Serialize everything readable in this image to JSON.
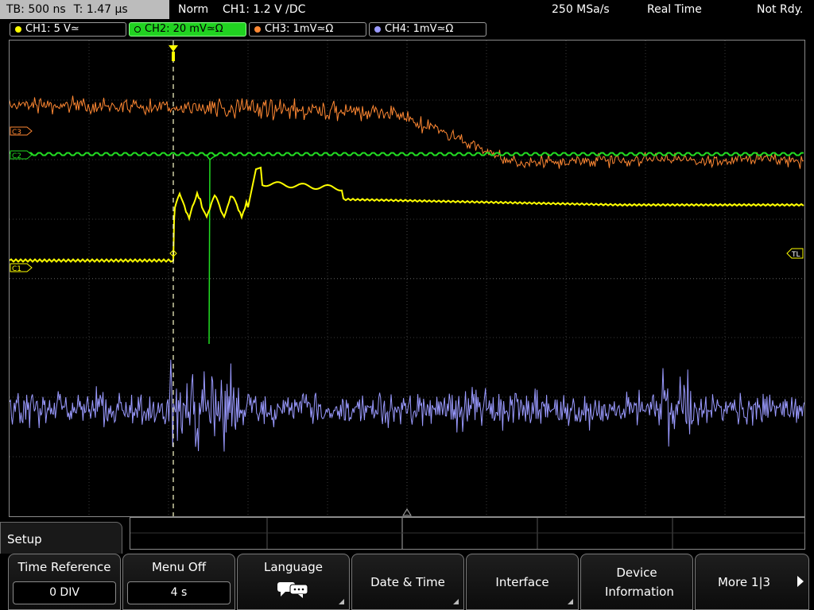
{
  "topbar": {
    "timebase": "TB: 500 ns",
    "trig_pos": "T: 1.47 µs",
    "acq_mode": "Norm",
    "trigger": "CH1: 1.2 V ∕DC",
    "sample_rate": "250 MSa/s",
    "mode": "Real Time",
    "status": "Not Rdy."
  },
  "channels": [
    {
      "label": "CH1: 5 V≃",
      "color": "#ffff00"
    },
    {
      "label": "CH2: 20 mV≃Ω",
      "color": "#22dd22"
    },
    {
      "label": "CH3: 1mV≃Ω",
      "color": "#ff8833"
    },
    {
      "label": "CH4: 1mV≃Ω",
      "color": "#9a9aff"
    }
  ],
  "markers": {
    "c3": "C3",
    "c2": "C2",
    "c1": "C1",
    "tl": "TL"
  },
  "menu": {
    "title": "Setup",
    "softkeys": [
      {
        "label": "Time Reference",
        "value": "0 DIV"
      },
      {
        "label": "Menu Off",
        "value": "4 s"
      },
      {
        "label": "Language",
        "icon": "speech-bubble-icon"
      },
      {
        "label": "Date & Time"
      },
      {
        "label": "Interface"
      },
      {
        "label": "Device Information"
      },
      {
        "label": "More 1|3"
      }
    ]
  }
}
